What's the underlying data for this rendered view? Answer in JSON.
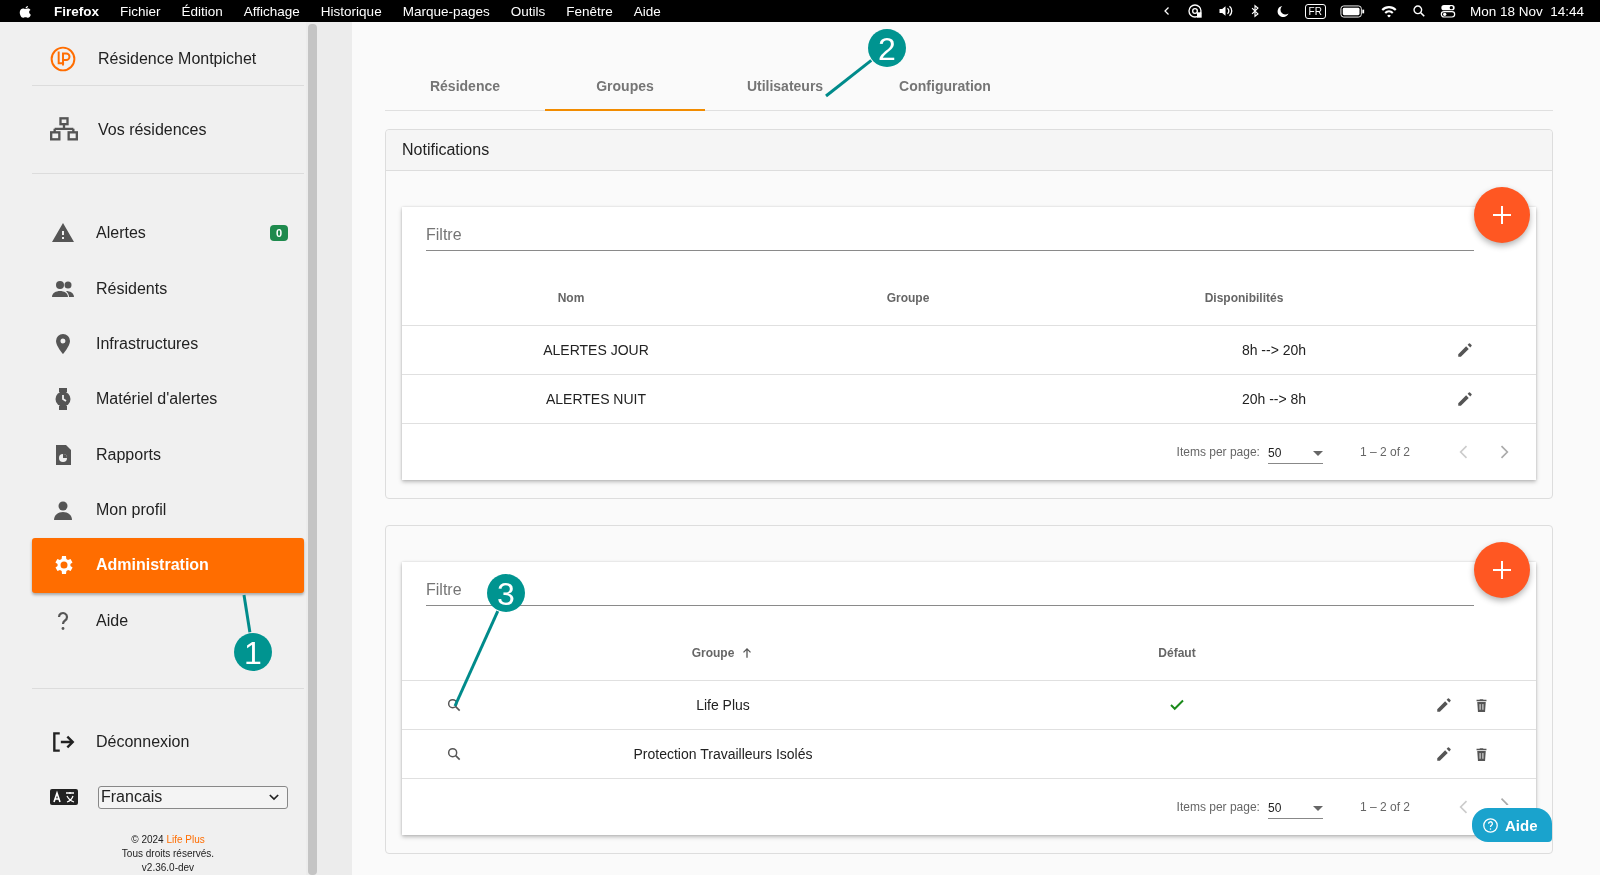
{
  "menubar": {
    "app": "Firefox",
    "menus": [
      "Fichier",
      "Édition",
      "Affichage",
      "Historique",
      "Marque-pages",
      "Outils",
      "Fenêtre",
      "Aide"
    ],
    "input_source": "FR",
    "clock": "Mon 18 Nov  14:44"
  },
  "sidebar": {
    "residence": "Résidence Montpichet",
    "residences_link": "Vos résidences",
    "items": [
      {
        "label": "Alertes",
        "selected": false,
        "badge": "0"
      },
      {
        "label": "Résidents",
        "selected": false
      },
      {
        "label": "Infrastructures",
        "selected": false
      },
      {
        "label": "Matériel d'alertes",
        "selected": false
      },
      {
        "label": "Rapports",
        "selected": false
      },
      {
        "label": "Mon profil",
        "selected": false
      },
      {
        "label": "Administration",
        "selected": true
      },
      {
        "label": "Aide",
        "selected": false
      }
    ],
    "logout": "Déconnexion",
    "language": "Francais",
    "footer": {
      "copyright": "© 2024 ",
      "brand": "Life Plus",
      "rights": "Tous droits réservés.",
      "version": "v2.36.0-dev"
    }
  },
  "tabs": [
    {
      "label": "Résidence",
      "selected": false
    },
    {
      "label": "Groupes",
      "selected": true
    },
    {
      "label": "Utilisateurs",
      "selected": false
    },
    {
      "label": "Configuration",
      "selected": false
    }
  ],
  "cards": [
    {
      "kind": "notifications",
      "title": "Notifications",
      "filter_placeholder": "Filtre",
      "columns": [
        {
          "label": "Nom"
        },
        {
          "label": "Groupe"
        },
        {
          "label": "Disponibilités"
        }
      ],
      "rows": [
        {
          "name": "ALERTES JOUR",
          "availability": "8h --> 20h"
        },
        {
          "name": "ALERTES NUIT",
          "availability": "20h --> 8h"
        }
      ],
      "paginator": {
        "label": "Items per page:",
        "page_size": "50",
        "range": "1 – 2 of 2"
      }
    },
    {
      "kind": "groups",
      "filter_placeholder": "Filtre",
      "columns": [
        {
          "label": "Groupe",
          "sorted": true
        },
        {
          "label": "Défaut",
          "sorted": false
        }
      ],
      "rows": [
        {
          "name": "Life Plus",
          "default": true
        },
        {
          "name": "Protection Travailleurs Isolés",
          "default": false
        }
      ],
      "paginator": {
        "label": "Items per page:",
        "page_size": "50",
        "range": "1 – 2 of 2"
      }
    }
  ],
  "help_button": "Aide",
  "annotations": [
    {
      "label": "1"
    },
    {
      "label": "2"
    },
    {
      "label": "3"
    }
  ]
}
